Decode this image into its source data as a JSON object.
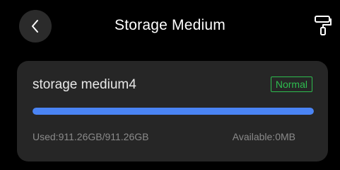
{
  "header": {
    "title": "Storage Medium",
    "back_icon": "chevron-left-icon",
    "tool_icon": "paint-roller-icon"
  },
  "storage": {
    "name": "storage medium4",
    "status": "Normal",
    "used_label": "Used:911.26GB/911.26GB",
    "available_label": "Available:0MB",
    "usage_fraction": 1.0
  },
  "colors": {
    "background": "#000000",
    "card": "#262626",
    "status_green": "#2ebd4f",
    "progress_blue": "#4a84f4"
  }
}
